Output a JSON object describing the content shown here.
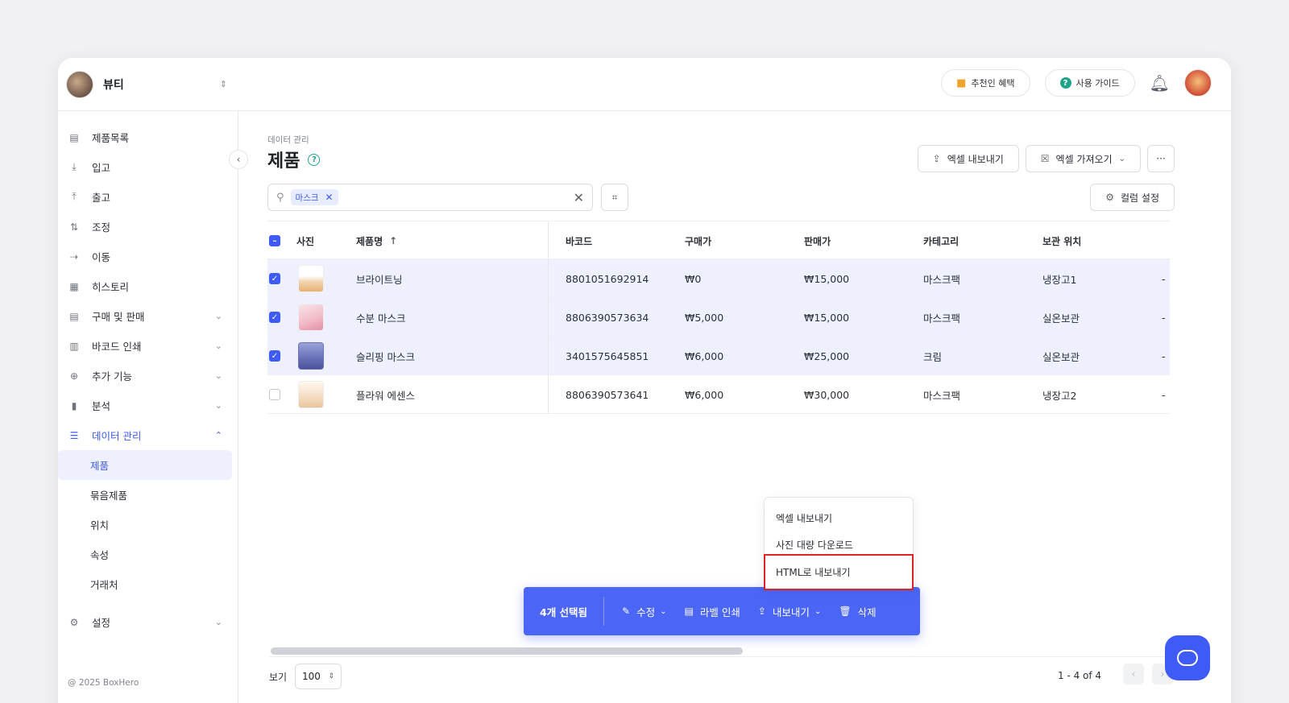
{
  "workspace": {
    "name": "뷰티"
  },
  "topbar": {
    "referral": "추천인 혜택",
    "guide": "사용 가이드",
    "help_glyph": "?"
  },
  "sidebar": {
    "items": [
      {
        "icon": "product-list-icon",
        "glyph": "▤",
        "label": "제품목록"
      },
      {
        "icon": "inbound-icon",
        "glyph": "⤓",
        "label": "입고"
      },
      {
        "icon": "outbound-icon",
        "glyph": "⤒",
        "label": "출고"
      },
      {
        "icon": "adjust-icon",
        "glyph": "⇅",
        "label": "조정"
      },
      {
        "icon": "move-icon",
        "glyph": "⇢",
        "label": "이동"
      },
      {
        "icon": "history-icon",
        "glyph": "▦",
        "label": "히스토리"
      },
      {
        "icon": "purchase-sales-icon",
        "glyph": "▤",
        "label": "구매 및 판매"
      },
      {
        "icon": "barcode-print-icon",
        "glyph": "▥",
        "label": "바코드 인쇄"
      },
      {
        "icon": "add-feature-icon",
        "glyph": "⊕",
        "label": "추가 기능"
      },
      {
        "icon": "analytics-icon",
        "glyph": "▮",
        "label": "분석"
      },
      {
        "icon": "data-management-icon",
        "glyph": "☰",
        "label": "데이터 관리"
      }
    ],
    "sub_items": [
      "제품",
      "묶음제품",
      "위치",
      "속성",
      "거래처"
    ],
    "settings": "설정",
    "copyright": "@ 2025 BoxHero"
  },
  "main": {
    "breadcrumb": "데이터 관리",
    "title": "제품",
    "export_excel": "엑셀 내보내기",
    "import_excel": "엑셀 가져오기",
    "more": "···",
    "search_chip": "마스크",
    "column_settings": "컬럼 설정"
  },
  "table": {
    "headers": [
      "사진",
      "제품명",
      "바코드",
      "구매가",
      "판매가",
      "카테고리",
      "보관 위치"
    ],
    "rows": [
      {
        "name": "브라이트닝",
        "barcode": "8801051692914",
        "purchase": "₩0",
        "sale": "₩15,000",
        "category": "마스크팩",
        "location": "냉장고1",
        "extra": "-",
        "selected": true
      },
      {
        "name": "수분 마스크",
        "barcode": "8806390573634",
        "purchase": "₩5,000",
        "sale": "₩15,000",
        "category": "마스크팩",
        "location": "실온보관",
        "extra": "-",
        "selected": true
      },
      {
        "name": "슬리핑 마스크",
        "barcode": "3401575645851",
        "purchase": "₩6,000",
        "sale": "₩25,000",
        "category": "크림",
        "location": "실온보관",
        "extra": "-",
        "selected": true
      },
      {
        "name": "플라워 에센스",
        "barcode": "8806390573641",
        "purchase": "₩6,000",
        "sale": "₩30,000",
        "category": "마스크팩",
        "location": "냉장고2",
        "extra": "-",
        "selected": false
      }
    ]
  },
  "export_menu": {
    "items": [
      "엑셀 내보내기",
      "사진 대량 다운로드",
      "HTML로 내보내기"
    ]
  },
  "action_bar": {
    "count": "4개 선택됨",
    "edit": "수정",
    "print_label": "라벨 인쇄",
    "export": "내보내기",
    "delete": "삭제"
  },
  "footer": {
    "page_size_label": "보기",
    "page_size": "100",
    "pager": "1 - 4 of 4"
  }
}
